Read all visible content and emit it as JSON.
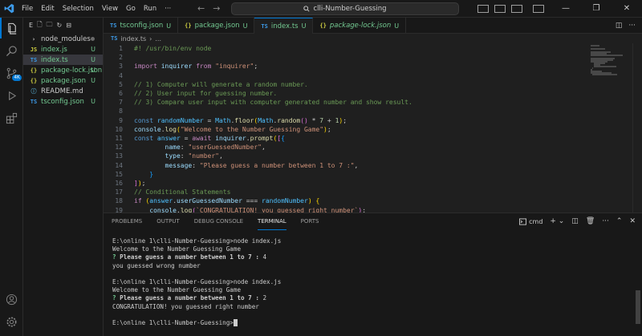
{
  "titlebar": {
    "menu": [
      "File",
      "Edit",
      "Selection",
      "View",
      "Go",
      "Run",
      "···"
    ],
    "search": "clli-Number-Guessing",
    "back": "←",
    "forward": "→"
  },
  "sidebar": {
    "header": "E",
    "items": [
      {
        "icon": "›",
        "label": "node_modules",
        "status": "•",
        "kind": "folder"
      },
      {
        "icon": "JS",
        "label": "index.js",
        "status": "U",
        "kind": "js"
      },
      {
        "icon": "TS",
        "label": "index.ts",
        "status": "U",
        "kind": "ts",
        "selected": true
      },
      {
        "icon": "{}",
        "label": "package-lock.json",
        "status": "U",
        "kind": "json"
      },
      {
        "icon": "{}",
        "label": "package.json",
        "status": "U",
        "kind": "json"
      },
      {
        "icon": "ⓘ",
        "label": "README.md",
        "status": "",
        "kind": "md"
      },
      {
        "icon": "TS",
        "label": "tsconfig.json",
        "status": "U",
        "kind": "tsconfig"
      }
    ]
  },
  "tabs": [
    {
      "icon": "TS",
      "label": "tsconfig.json",
      "status": "U"
    },
    {
      "icon": "{}",
      "label": "package.json",
      "status": "U"
    },
    {
      "icon": "TS",
      "label": "index.ts",
      "status": "U",
      "active": true
    },
    {
      "icon": "{}",
      "label": "package-lock.json",
      "status": "U",
      "italic": true
    }
  ],
  "breadcrumb": {
    "file_icon": "TS",
    "file": "index.ts",
    "sep": "›",
    "rest": "..."
  },
  "editor": {
    "lines": [
      {
        "n": "1",
        "html": "<span class=\"cm\">#! /usr/bin/env node</span>"
      },
      {
        "n": "2",
        "html": ""
      },
      {
        "n": "3",
        "html": "<span class=\"kw\">import</span> <span class=\"vr\">inquirer</span> <span class=\"kw\">from</span> <span class=\"str\">\"inquirer\"</span>;"
      },
      {
        "n": "4",
        "html": ""
      },
      {
        "n": "5",
        "html": "<span class=\"cm\">// 1) Computer will generate a random number.</span>"
      },
      {
        "n": "6",
        "html": "<span class=\"cm\">// 2) User input for guessing number.</span>"
      },
      {
        "n": "7",
        "html": "<span class=\"cm\">// 3) Compare user input with computer generated number and show result.</span>"
      },
      {
        "n": "8",
        "html": ""
      },
      {
        "n": "9",
        "html": "<span class=\"dec\">const</span> <span class=\"cn\">randomNumber</span> = <span class=\"cn\">Math</span>.<span class=\"fn\">floor</span><span class=\"br1\">(</span><span class=\"cn\">Math</span>.<span class=\"fn\">random</span><span class=\"br2\">()</span> * <span class=\"num\">7</span> + <span class=\"num\">1</span><span class=\"br1\">)</span>;"
      },
      {
        "n": "10",
        "html": "<span class=\"vr\">console</span>.<span class=\"fn\">log</span><span class=\"br1\">(</span><span class=\"str\">\"Welcome to the Number Guessing Game\"</span><span class=\"br1\">)</span>;"
      },
      {
        "n": "11",
        "html": "<span class=\"dec\">const</span> <span class=\"cn\">answer</span> = <span class=\"kw\">await</span> <span class=\"vr\">inquirer</span>.<span class=\"fn\">prompt</span><span class=\"br1\">(</span><span class=\"br2\">[</span><span class=\"br3\">{</span>"
      },
      {
        "n": "12",
        "html": "        <span class=\"vr\">name</span>: <span class=\"str\">\"userGuessedNumber\"</span>,"
      },
      {
        "n": "13",
        "html": "        <span class=\"vr\">type</span>: <span class=\"str\">\"number\"</span>,"
      },
      {
        "n": "14",
        "html": "        <span class=\"vr\">message</span>: <span class=\"str\">\"Please guess a number between 1 to 7 :\"</span>,"
      },
      {
        "n": "15",
        "html": "    <span class=\"br3\">}</span>"
      },
      {
        "n": "16",
        "html": "<span class=\"br2\">]</span><span class=\"br1\">)</span>;"
      },
      {
        "n": "17",
        "html": "<span class=\"cm\">// Conditional Statements</span>"
      },
      {
        "n": "18",
        "html": "<span class=\"kw\">if</span> <span class=\"br1\">(</span><span class=\"cn\">answer</span>.<span class=\"vr\">userGuessedNumber</span> === <span class=\"cn\">randomNumber</span><span class=\"br1\">)</span> <span class=\"br1\">{</span>"
      },
      {
        "n": "19",
        "html": "    <span class=\"vr\">console</span>.<span class=\"fn\">log</span><span class=\"br2\">(</span><span class=\"str\">`CONGRATULATION! you guessed right number`</span><span class=\"br2\">)</span>;"
      }
    ]
  },
  "panel": {
    "tabs": [
      "PROBLEMS",
      "OUTPUT",
      "DEBUG CONSOLE",
      "TERMINAL",
      "PORTS"
    ],
    "active_tab": 3,
    "terminal_name": "cmd",
    "terminal_lines": [
      {
        "text": "E:\\online 1\\clli-Number-Guessing>node index.js",
        "bold": false
      },
      {
        "text": "Welcome to the Number Guessing Game",
        "bold": false
      },
      {
        "prefix": "? ",
        "text": "Please guess a number between 1 to 7 : ",
        "answer": "4",
        "bold": true
      },
      {
        "text": "you guessed wrong number",
        "bold": false
      },
      {
        "text": "",
        "bold": false
      },
      {
        "text": "E:\\online 1\\clli-Number-Guessing>node index.js",
        "bold": false
      },
      {
        "text": "Welcome to the Number Guessing Game",
        "bold": false
      },
      {
        "prefix": "? ",
        "text": "Please guess a number between 1 to 7 : ",
        "answer": "2",
        "bold": true
      },
      {
        "text": "CONGRATULATION! you guessed right number",
        "bold": false
      },
      {
        "text": "",
        "bold": false
      },
      {
        "text": "E:\\online 1\\clli-Number-Guessing>",
        "bold": false,
        "cursor": true
      }
    ]
  },
  "activity_badge": "4K",
  "colors": {
    "accent": "#0078d4",
    "untracked": "#73c991"
  }
}
